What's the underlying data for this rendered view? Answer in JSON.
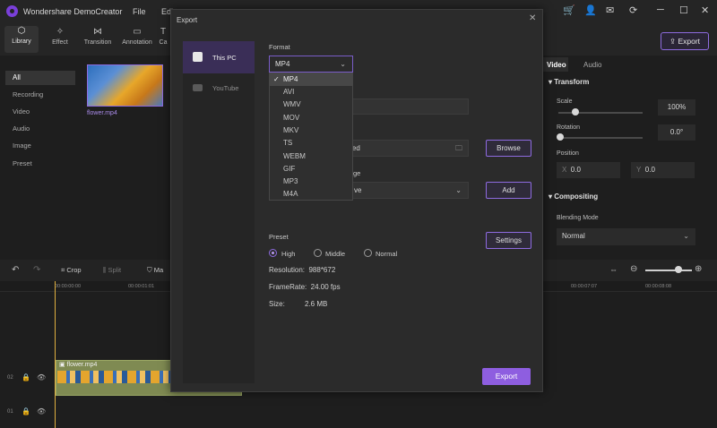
{
  "app": {
    "title": "Wondershare DemoCreator"
  },
  "menu": [
    "File",
    "Edit"
  ],
  "toolbar": {
    "tools": [
      "Library",
      "Effect",
      "Transition",
      "Annotation",
      "Ca"
    ],
    "export_label": "Export"
  },
  "library": {
    "categories": [
      "All",
      "Recording",
      "Video",
      "Audio",
      "Image",
      "Preset"
    ],
    "clip_name": "flower.mp4"
  },
  "properties": {
    "tabs": [
      "Video",
      "Audio"
    ],
    "transform_title": "Transform",
    "scale_label": "Scale",
    "scale_value": "100%",
    "rotation_label": "Rotation",
    "rotation_value": "0.0°",
    "position_label": "Position",
    "x_label": "X",
    "x_value": "0.0",
    "y_label": "Y",
    "y_value": "0.0",
    "compositing_title": "Compositing",
    "blending_label": "Blending Mode",
    "blending_value": "Normal"
  },
  "timeline": {
    "tools": [
      "Crop",
      "Split",
      "Ma"
    ],
    "ruler": [
      "00:00:00:00",
      "00:00:01:01",
      "00:00:07:07",
      "00:00:08:08"
    ],
    "clip_name": "flower.mp4",
    "tracks": [
      "02",
      "01"
    ]
  },
  "dialog": {
    "title": "Export",
    "tabs": [
      "This PC",
      "YouTube"
    ],
    "format_label": "Format",
    "format_value": "MP4",
    "format_options": [
      "MP4",
      "AVI",
      "WMV",
      "MOV",
      "MKV",
      "TS",
      "WEBM",
      "GIF",
      "MP3",
      "M4A"
    ],
    "selected_format": "MP4",
    "path_value": "aded",
    "browse_label": "Browse",
    "quality_label": "ge",
    "quality_value": "ve",
    "add_label": "Add",
    "preset_label": "Preset",
    "preset_options": [
      "High",
      "Middle",
      "Normal"
    ],
    "preset_selected": "High",
    "settings_label": "Settings",
    "resolution": "Resolution:  988*672",
    "framerate": "FrameRate:  24.00 fps",
    "size": "Size:          2.6 MB",
    "export_label": "Export"
  }
}
